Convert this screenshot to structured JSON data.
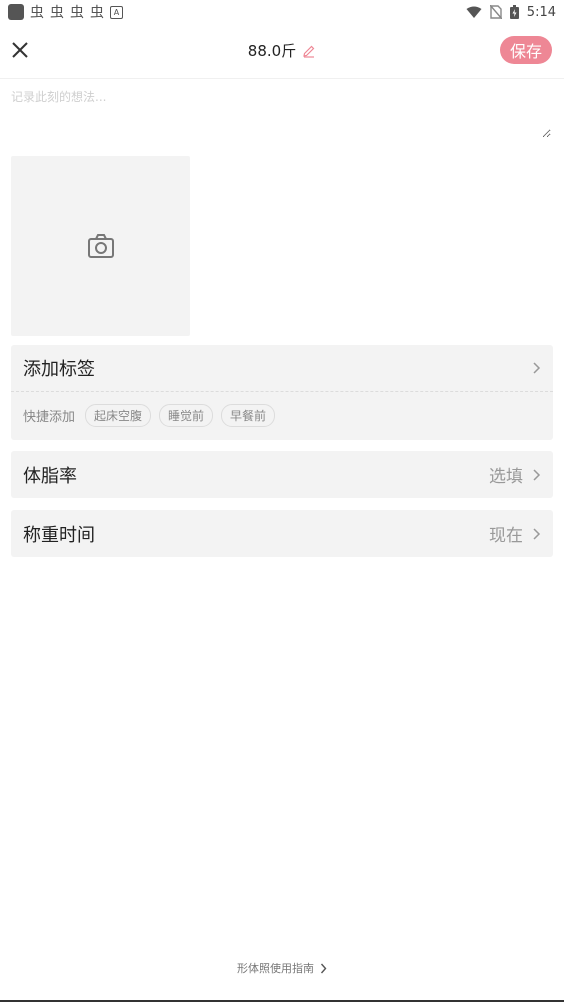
{
  "status_bar": {
    "time": "5:14",
    "left_glyph": "虫",
    "left_badge": "A"
  },
  "header": {
    "title": "88.0斤",
    "save_label": "保存"
  },
  "note": {
    "placeholder": "记录此刻的想法..."
  },
  "tags": {
    "title": "添加标签",
    "quick_label": "快捷添加",
    "chips": [
      "起床空腹",
      "睡觉前",
      "早餐前"
    ]
  },
  "body_fat": {
    "label": "体脂率",
    "value": "选填"
  },
  "weigh_time": {
    "label": "称重时间",
    "value": "现在"
  },
  "footer": {
    "guide_label": "形体照使用指南"
  },
  "colors": {
    "accent": "#ee8795",
    "card_bg": "#f3f3f3"
  }
}
